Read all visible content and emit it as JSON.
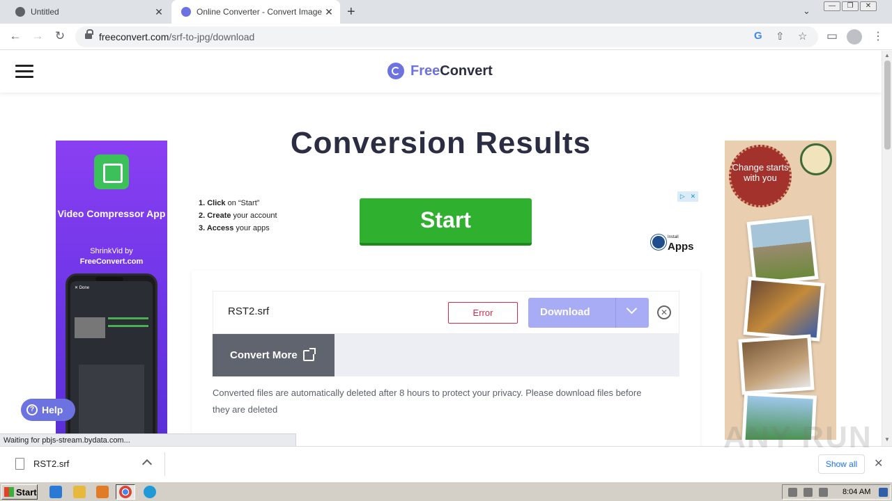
{
  "browser": {
    "tabs": [
      {
        "title": "Untitled",
        "close": "✕"
      },
      {
        "title": "Online Converter - Convert Image, V",
        "close": "✕"
      }
    ],
    "new_tab": "+",
    "url_host": "freeconvert.com",
    "url_path": "/srf-to-jpg/download"
  },
  "site": {
    "logo_free": "Free",
    "logo_convert": "Convert",
    "page_title": "Conversion Results",
    "help_label": "Help"
  },
  "ad_left": {
    "heading": "Video Compressor App",
    "by_line": "ShrinkVid by",
    "by_brand": "FreeConvert.com",
    "phone_top": "✕ Done"
  },
  "ad_top": {
    "step1_bold": "1. Click",
    "step1_rest": " on “Start”",
    "step2_bold": "2. Create",
    "step2_rest": " your account",
    "step3_bold": "3. Access",
    "step3_rest": " your apps",
    "start_label": "Start",
    "install_small": "Install",
    "install_big": "Apps"
  },
  "results": {
    "file_name": "RST2.srf",
    "status": "Error",
    "download_label": "Download",
    "convert_more_label": "Convert More",
    "notice": "Converted files are automatically deleted after 8 hours to protect your privacy. Please download files before they are deleted"
  },
  "ad_right": {
    "seal_text": "Change starts with you"
  },
  "status_bubble": "Waiting for pbjs-stream.bydata.com...",
  "download_shelf": {
    "file_name": "RST2.srf",
    "show_all": "Show all"
  },
  "watermark": "ANY RUN",
  "taskbar": {
    "start_label": "Start",
    "clock": "8:04 AM"
  },
  "colors": {
    "brand": "#6c72e0",
    "start_green": "#2fb12f",
    "error_red": "#d42a4a",
    "download_disabled": "#a8acf4"
  }
}
